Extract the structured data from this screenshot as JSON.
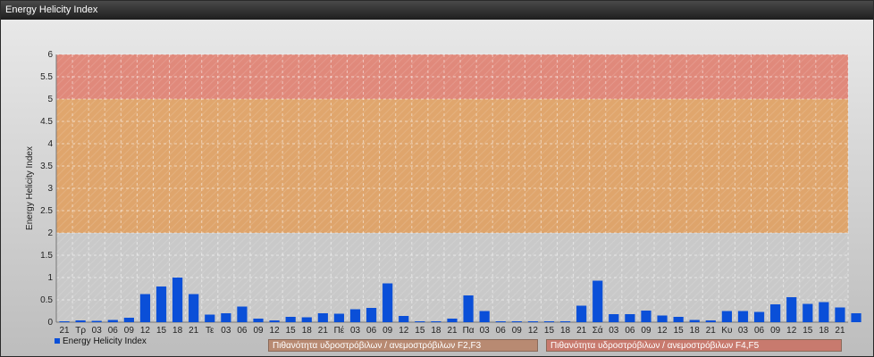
{
  "window": {
    "title": "Energy Helicity Index"
  },
  "colors": {
    "bar": "#0a4fd8",
    "band_low": "#c9c9c9",
    "band_mid": "#e0a060",
    "band_high": "#e08070"
  },
  "legend": {
    "series_label": "Energy Helicity Index",
    "band_mid_label": "Πιθανότητα υδροστρόβιλων / ανεμοστρόβιλων F2,F3",
    "band_high_label": "Πιθανότητα υδροστρόβιλων / ανεμοστρόβιλων F4,F5"
  },
  "chart_data": {
    "type": "bar",
    "ylabel": "Energy Helicity Index",
    "ylim": [
      0,
      6
    ],
    "yticks": [
      "0",
      "0.5",
      "1",
      "1.5",
      "2",
      "2.5",
      "3",
      "3.5",
      "4",
      "4.5",
      "5",
      "5.5",
      "6"
    ],
    "grid": true,
    "bands": [
      {
        "from": 0,
        "to": 2,
        "color": "#c9c9c9"
      },
      {
        "from": 2,
        "to": 5,
        "color": "#e0a060"
      },
      {
        "from": 5,
        "to": 6,
        "color": "#e08070"
      }
    ],
    "categories": [
      "21",
      "Τρ",
      "03",
      "06",
      "09",
      "12",
      "15",
      "18",
      "21",
      "Τε",
      "03",
      "06",
      "09",
      "12",
      "15",
      "18",
      "21",
      "Πέ",
      "03",
      "06",
      "09",
      "12",
      "15",
      "18",
      "21",
      "Πα",
      "03",
      "06",
      "09",
      "12",
      "15",
      "18",
      "21",
      "Σά",
      "03",
      "06",
      "09",
      "12",
      "15",
      "18",
      "21",
      "Κυ",
      "03",
      "06",
      "09",
      "12",
      "15",
      "18",
      "21"
    ],
    "values": [
      0.02,
      0.04,
      0.03,
      0.05,
      0.1,
      0.63,
      0.8,
      1.0,
      0.63,
      0.17,
      0.2,
      0.35,
      0.08,
      0.04,
      0.12,
      0.11,
      0.2,
      0.19,
      0.29,
      0.32,
      0.87,
      0.14,
      0.02,
      0.02,
      0.08,
      0.6,
      0.25,
      0.02,
      0.02,
      0.02,
      0.02,
      0.02,
      0.37,
      0.93,
      0.18,
      0.18,
      0.26,
      0.15,
      0.12,
      0.05,
      0.04,
      0.25,
      0.25,
      0.23,
      0.4,
      0.56,
      0.41,
      0.45,
      0.33,
      0.2
    ]
  }
}
